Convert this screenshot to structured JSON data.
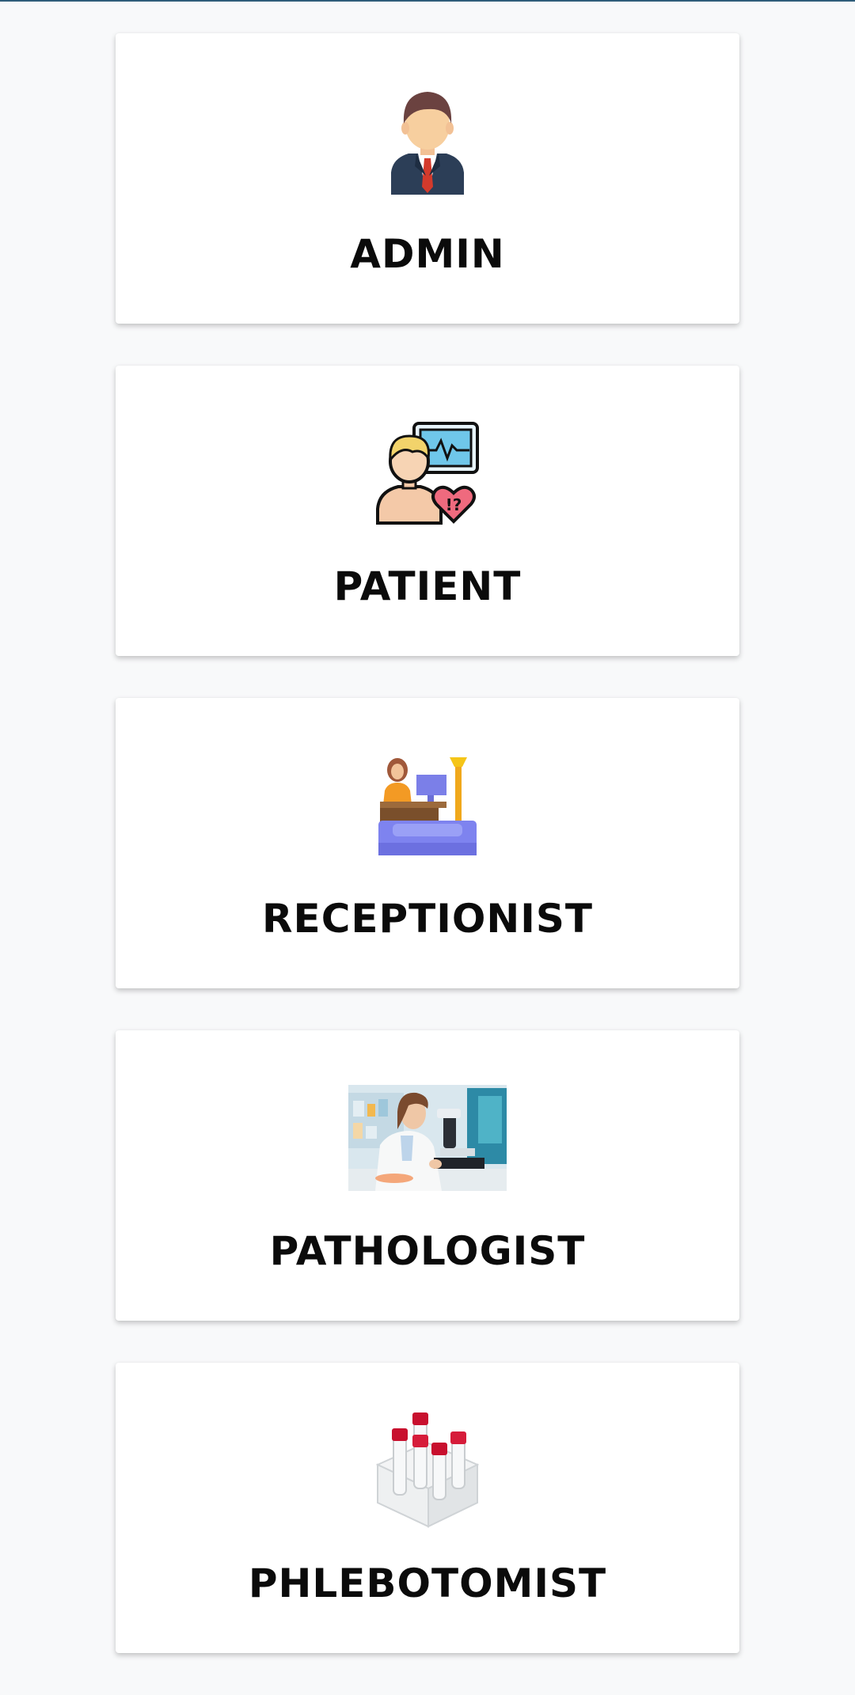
{
  "roles": [
    {
      "label": "ADMIN",
      "icon": "admin-user-icon"
    },
    {
      "label": "PATIENT",
      "icon": "patient-monitor-heart-icon"
    },
    {
      "label": "RECEPTIONIST",
      "icon": "receptionist-desk-icon"
    },
    {
      "label": "PATHOLOGIST",
      "icon": "pathologist-microscope-photo"
    },
    {
      "label": "PHLEBOTOMIST",
      "icon": "blood-test-tubes-icon"
    }
  ],
  "colors": {
    "background": "#f8f9fa",
    "card": "#ffffff",
    "text": "#0b0b0b",
    "top_border": "#2f5d79"
  }
}
